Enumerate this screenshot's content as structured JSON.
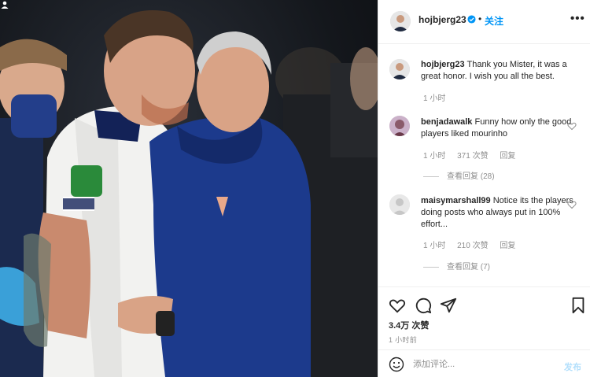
{
  "post": {
    "username": "hojbjerg23",
    "follow_label": "关注",
    "separator": "•",
    "more_icon": "more-horizontal-icon",
    "verified_color": "#0095f6"
  },
  "comments": [
    {
      "username": "hojbjerg23",
      "text": "Thank you Mister, it was a great honor. I wish you all the best.",
      "time": "1 小时",
      "likes": "",
      "reply_label": "",
      "view_replies": ""
    },
    {
      "username": "benjadawalk",
      "text": "Funny how only the good players liked mourinho",
      "time": "1 小时",
      "likes": "371 次赞",
      "reply_label": "回复",
      "view_replies": "查看回复 (28)"
    },
    {
      "username": "maisymarshall99",
      "text": "Notice its the players doing posts who always put in 100% effort...",
      "time": "1 小时",
      "likes": "210 次赞",
      "reply_label": "回复",
      "view_replies": "查看回复 (7)"
    }
  ],
  "actions": {
    "like_icon": "heart-icon",
    "comment_icon": "comment-icon",
    "share_icon": "send-icon",
    "save_icon": "bookmark-icon",
    "likes_count": "3.4万 次赞",
    "time": "1 小时前"
  },
  "add_comment": {
    "placeholder": "添加评论...",
    "post_label": "发布",
    "emoji_icon": "emoji-icon"
  },
  "colors": {
    "accent": "#0095f6",
    "spurs_navy": "#132257",
    "jacket_blue": "#1c3a8c"
  }
}
